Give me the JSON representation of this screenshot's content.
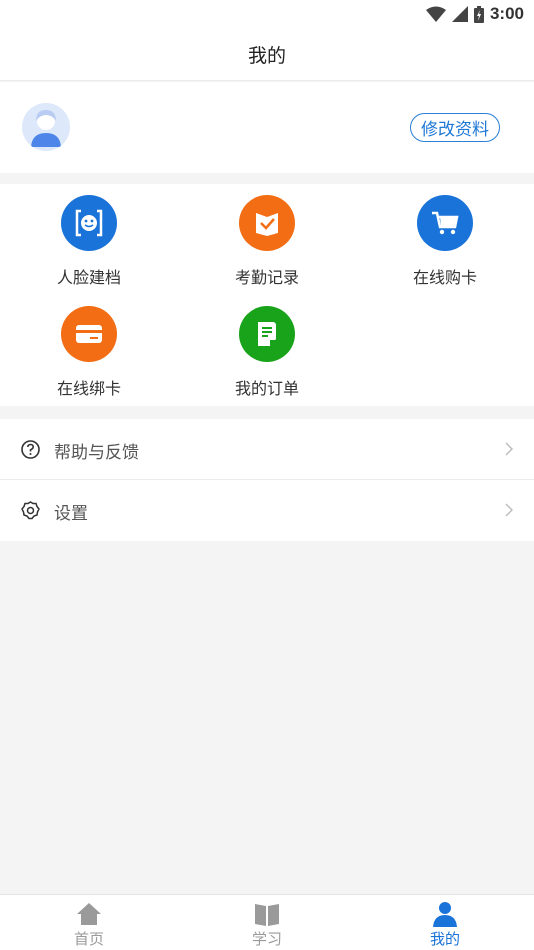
{
  "status_bar": {
    "time": "3:00",
    "icons": [
      "wifi-icon",
      "signal-icon",
      "battery-icon"
    ]
  },
  "header": {
    "title": "我的"
  },
  "profile": {
    "edit_label": "修改资料",
    "avatar_icon": "avatar-icon"
  },
  "features": [
    {
      "label": "人脸建档",
      "icon": "face-scan-icon",
      "color": "#1a73d9"
    },
    {
      "label": "考勤记录",
      "icon": "attendance-check-icon",
      "color": "#f26d13"
    },
    {
      "label": "在线购卡",
      "icon": "shopping-cart-icon",
      "color": "#1a73d9"
    },
    {
      "label": "在线绑卡",
      "icon": "card-icon",
      "color": "#f26d13"
    },
    {
      "label": "我的订单",
      "icon": "order-document-icon",
      "color": "#19a31a"
    }
  ],
  "menu": [
    {
      "label": "帮助与反馈",
      "icon": "help-icon"
    },
    {
      "label": "设置",
      "icon": "settings-gear-icon"
    }
  ],
  "tabs": [
    {
      "label": "首页",
      "icon": "home-icon",
      "active": false
    },
    {
      "label": "学习",
      "icon": "book-icon",
      "active": false
    },
    {
      "label": "我的",
      "icon": "user-icon",
      "active": true
    }
  ],
  "colors": {
    "accent": "#1a73d9",
    "inactive": "#9a9a9a",
    "background": "#f4f4f4"
  }
}
